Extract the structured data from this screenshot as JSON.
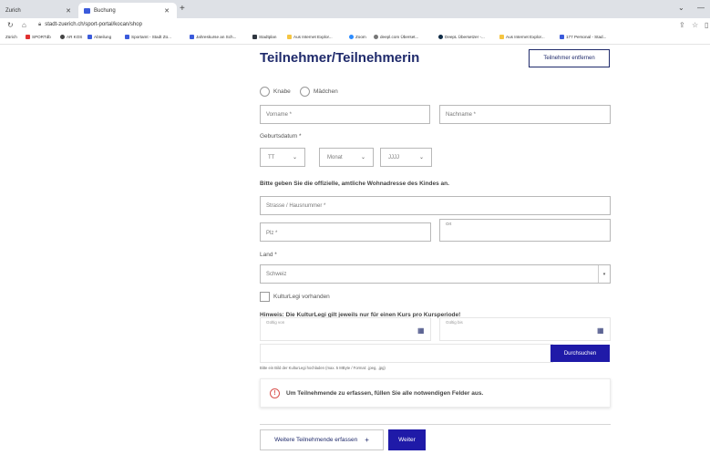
{
  "browser": {
    "tabs": [
      {
        "label": "Zurich"
      },
      {
        "label": "Buchung"
      }
    ],
    "new_tab": "+",
    "url": "stadt-zuerich.ch/sport-portal/kocan/shop",
    "bookmarks": [
      {
        "label": "Zürich",
        "color": "#ffffff"
      },
      {
        "label": "SPORTdb",
        "color": "#e03131"
      },
      {
        "label": "AR KOS",
        "color": "#444444"
      },
      {
        "label": "Abteilung",
        "color": "#3b5bdb"
      },
      {
        "label": "Sportamt - Stadt Zü...",
        "color": "#3b5bdb"
      },
      {
        "label": "Jahreskurse an Sch...",
        "color": "#3b5bdb"
      },
      {
        "label": "Stadtplan",
        "color": "#2f3640"
      },
      {
        "label": "Aus Internet Explor...",
        "color": "#f5c542"
      },
      {
        "label": "Zoom",
        "color": "#2d8cff"
      },
      {
        "label": "deepl.com Überset...",
        "color": "#555555"
      },
      {
        "label": "DeepL Übersetzer -...",
        "color": "#0f2b46"
      },
      {
        "label": "Aus Internet Explor...",
        "color": "#f5c542"
      },
      {
        "label": "177 Personal - Stad...",
        "color": "#3b5bdb"
      }
    ]
  },
  "form": {
    "title": "Teilnehmer/Teilnehmerin",
    "remove_button": "Teilnehmer entfernen",
    "gender_options": [
      "Knabe",
      "Mädchen"
    ],
    "firstname_placeholder": "Vorname *",
    "lastname_placeholder": "Nachname *",
    "birthdate_label": "Geburtsdatum *",
    "birth_day": "TT",
    "birth_month": "Monat",
    "birth_year": "JJJJ",
    "address_note": "Bitte geben Sie die offizielle, amtliche Wohnadresse des Kindes an.",
    "street_placeholder": "Strasse / Hausnummer *",
    "zip_placeholder": "Plz *",
    "city_placeholder": "Ort",
    "country_label": "Land *",
    "country_value": "Schweiz",
    "kulturlegi_checkbox": "KulturLegi vorhanden",
    "kulturlegi_hint": "Hinweis: Die KulturLegi gilt jeweils nur für einen Kurs pro Kursperiode!",
    "valid_from": "Gültig von",
    "valid_to": "Gültig bis",
    "search_button": "Durchsuchen",
    "upload_hint": "Bitte ein Bild der KulturLegi hochladen (max. 5 MByte / Format: .jpeg, .jpg)",
    "notice_text": "Um Teilnehmende zu erfassen, füllen Sie alle notwendigen Felder aus.",
    "add_more_button": "Weitere Teilnehmende erfassen",
    "add_more_plus": "+",
    "next_button": "Weiter"
  },
  "colors": {
    "brand": "#1f2a6b",
    "primary_button": "#1f1aa8",
    "error": "#d9534f"
  }
}
